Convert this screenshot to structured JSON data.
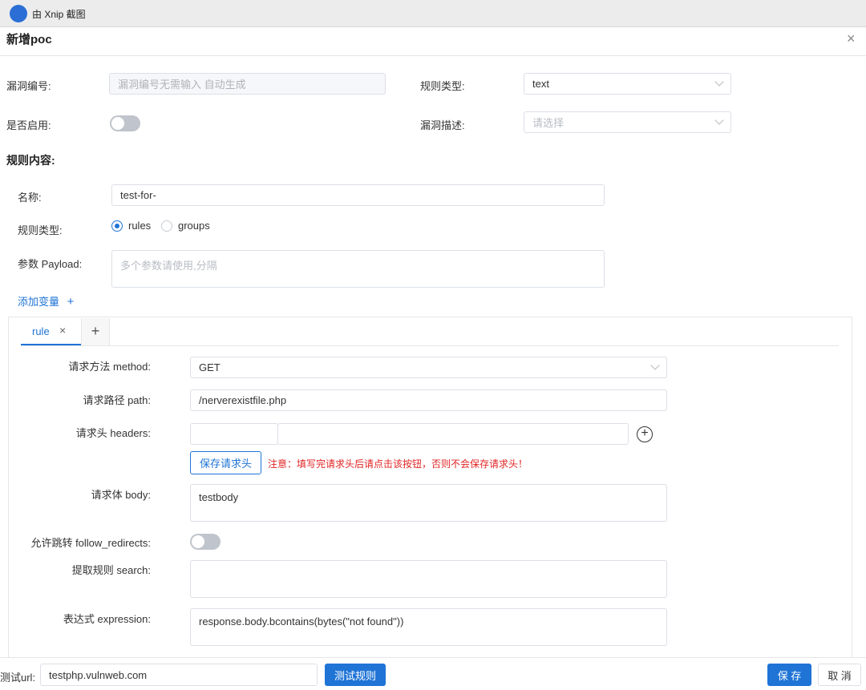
{
  "window": {
    "title": "由 Xnip 截图"
  },
  "dialog": {
    "title": "新增poc",
    "close_icon": "×"
  },
  "top_form": {
    "vuln_id_label": "漏洞编号:",
    "vuln_id_placeholder": "漏洞编号无需输入 自动生成",
    "rule_type_label": "规则类型:",
    "rule_type_value": "text",
    "enabled_label": "是否启用:",
    "desc_label": "漏洞描述:",
    "desc_placeholder": "请选择"
  },
  "rule_content": {
    "title": "规则内容:",
    "name_label": "名称:",
    "name_value": "test-for-",
    "type_label": "规则类型:",
    "type_options": [
      "rules",
      "groups"
    ],
    "payload_label": "参数 Payload:",
    "payload_placeholder": "多个参数请使用,分隔",
    "add_var_label": "添加变量",
    "add_var_icon": "+"
  },
  "tabs": {
    "active_label": "rule",
    "close_icon": "×",
    "add_icon": "+"
  },
  "rule_form": {
    "method_label": "请求方法 method:",
    "method_value": "GET",
    "path_label": "请求路径 path:",
    "path_value": "/nerverexistfile.php",
    "headers_label": "请求头 headers:",
    "headers_add_icon": "+",
    "save_headers_button": "保存请求头",
    "headers_warning": "注意：填写完请求头后请点击该按钮，否则不会保存请求头！",
    "body_label": "请求体 body:",
    "body_value": "testbody",
    "redirect_label": "允许跳转 follow_redirects:",
    "search_label": "提取规则 search:",
    "expression_label": "表达式 expression:",
    "expression_value": "response.body.bcontains(bytes(\"not found\"))"
  },
  "footer": {
    "test_url_label": "测试url:",
    "test_url_value": "testphp.vulnweb.com",
    "test_button": "测试规则",
    "save_button": "保 存",
    "cancel_button": "取 消"
  },
  "colors": {
    "primary": "#1f74d6",
    "warning": "#e02424"
  }
}
